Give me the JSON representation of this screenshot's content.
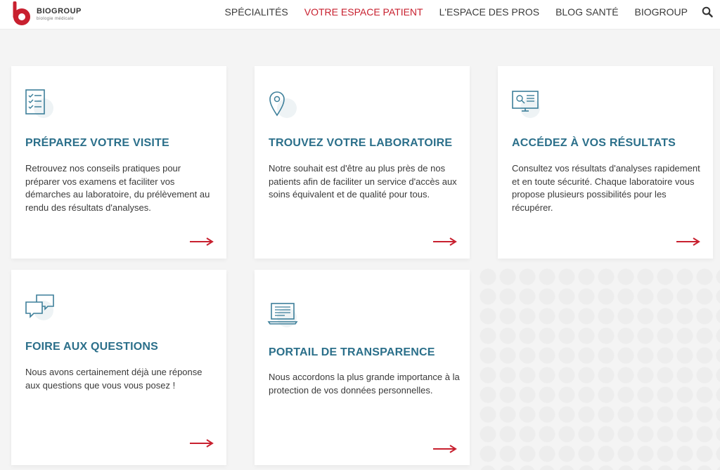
{
  "header": {
    "brand": {
      "name": "BIOGROUP",
      "tagline": "biologie médicale"
    },
    "nav": [
      {
        "label": "SPÉCIALITÉS",
        "active": false
      },
      {
        "label": "VOTRE ESPACE PATIENT",
        "active": true
      },
      {
        "label": "L'ESPACE DES PROS",
        "active": false
      },
      {
        "label": "BLOG SANTÉ",
        "active": false
      },
      {
        "label": "BIOGROUP",
        "active": false
      }
    ],
    "search_icon": "search-icon"
  },
  "colors": {
    "brand_red": "#c8202f",
    "title_blue": "#2b6f8a",
    "icon_blue": "#3d7f9a"
  },
  "cards": [
    {
      "icon": "checklist-icon",
      "title": "PRÉPAREZ VOTRE VISITE",
      "text": "Retrouvez nos conseils pratiques pour préparer vos examens et faciliter vos démarches au laboratoire, du prélèvement au rendu des résultats d'analyses."
    },
    {
      "icon": "location-pin-icon",
      "title": "TROUVEZ VOTRE LABORATOIRE",
      "text": "Notre souhait est d'être au plus près de nos patients afin de faciliter un service d'accès aux soins équivalent et de qualité pour tous."
    },
    {
      "icon": "results-screen-icon",
      "title": "ACCÉDEZ À VOS RÉSULTATS",
      "text": "Consultez vos résultats d'analyses rapidement et en toute sécurité. Chaque laboratoire vous propose plusieurs possibilités pour les récupérer."
    },
    {
      "icon": "chat-bubbles-icon",
      "title": "FOIRE AUX QUESTIONS",
      "text": "Nous avons certainement déjà une réponse aux questions que vous vous posez !"
    },
    {
      "icon": "laptop-icon",
      "title": "PORTAIL DE TRANSPARENCE",
      "text": "Nous accordons la plus grande importance à la protection de vos données personnelles."
    }
  ]
}
